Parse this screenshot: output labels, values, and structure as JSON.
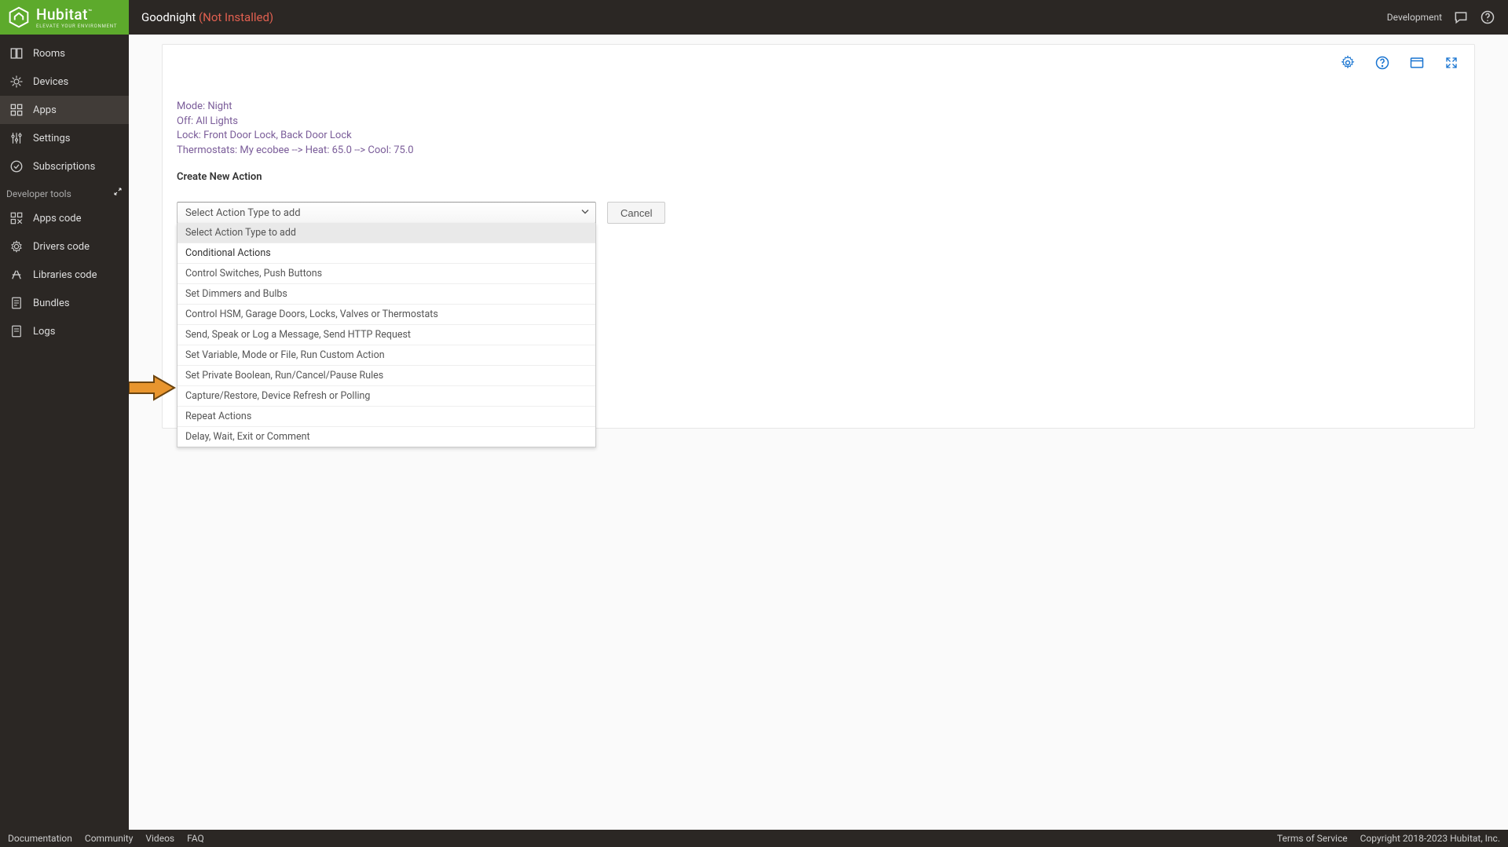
{
  "brand": {
    "name": "Hubitat",
    "tagline": "ELEVATE YOUR ENVIRONMENT",
    "sup": "™"
  },
  "header": {
    "title": "Goodnight ",
    "status": "(Not Installed)",
    "dev_label": "Development"
  },
  "sidebar": {
    "main": [
      {
        "label": "Rooms",
        "icon": "rooms"
      },
      {
        "label": "Devices",
        "icon": "devices"
      },
      {
        "label": "Apps",
        "icon": "apps"
      },
      {
        "label": "Settings",
        "icon": "settings"
      },
      {
        "label": "Subscriptions",
        "icon": "subscriptions"
      }
    ],
    "dev_section_label": "Developer tools",
    "dev": [
      {
        "label": "Apps code",
        "icon": "appscode"
      },
      {
        "label": "Drivers code",
        "icon": "driverscode"
      },
      {
        "label": "Libraries code",
        "icon": "librariescode"
      },
      {
        "label": "Bundles",
        "icon": "bundles"
      },
      {
        "label": "Logs",
        "icon": "logs"
      }
    ]
  },
  "rule": {
    "lines": [
      "Mode: Night",
      "Off: All Lights",
      "Lock: Front Door Lock, Back Door Lock",
      "Thermostats: My ecobee --> Heat: 65.0 --> Cool: 75.0"
    ],
    "create_label": "Create New Action"
  },
  "select": {
    "placeholder": "Select Action Type to add",
    "options": [
      "Select Action Type to add",
      "Conditional Actions",
      "Control Switches, Push Buttons",
      "Set Dimmers and Bulbs",
      "Control HSM, Garage Doors, Locks, Valves or Thermostats",
      "Send, Speak or Log a Message, Send HTTP Request",
      "Set Variable, Mode or File, Run Custom Action",
      "Set Private Boolean, Run/Cancel/Pause Rules",
      "Capture/Restore, Device Refresh or Polling",
      "Repeat Actions",
      "Delay, Wait, Exit or Comment"
    ]
  },
  "buttons": {
    "cancel": "Cancel"
  },
  "footer": {
    "left": [
      "Documentation",
      "Community",
      "Videos",
      "FAQ"
    ],
    "right": [
      "Terms of Service",
      "Copyright 2018-2023 Hubitat, Inc."
    ]
  }
}
